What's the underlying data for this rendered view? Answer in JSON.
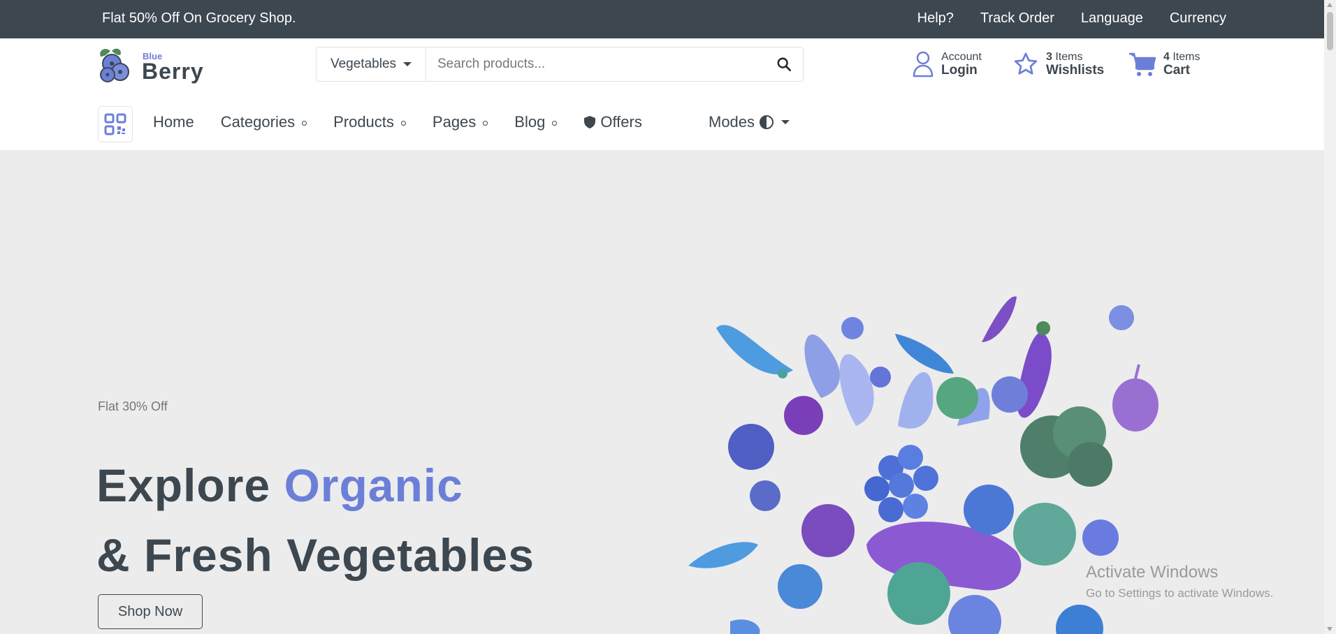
{
  "topbar": {
    "promo": "Flat 50% Off On Grocery Shop.",
    "links": [
      "Help?",
      "Track Order",
      "Language",
      "Currency"
    ]
  },
  "header": {
    "logo": {
      "small": "Blue",
      "big": "Berry"
    },
    "search": {
      "category": "Vegetables",
      "placeholder": "Search products..."
    },
    "account": {
      "small": "Account",
      "big": "Login"
    },
    "wishlist": {
      "count": "3",
      "small": "Items",
      "big": "Wishlists"
    },
    "cart": {
      "count": "4",
      "small": "Items",
      "big": "Cart"
    }
  },
  "nav": {
    "items": [
      {
        "label": "Home"
      },
      {
        "label": "Categories"
      },
      {
        "label": "Products"
      },
      {
        "label": "Pages"
      },
      {
        "label": "Blog"
      },
      {
        "label": "Offers"
      }
    ],
    "modes": "Modes"
  },
  "hero": {
    "sub": "Flat 30% Off",
    "title_a": "Explore ",
    "title_accent": "Organic",
    "title_b": "& Fresh Vegetables",
    "button": "Shop Now"
  },
  "watermark": {
    "title": "Activate Windows",
    "subtitle": "Go to Settings to activate Windows."
  },
  "colors": {
    "accent": "#6c7fd8",
    "dark": "#3d4750",
    "hero_bg": "#ececec"
  }
}
